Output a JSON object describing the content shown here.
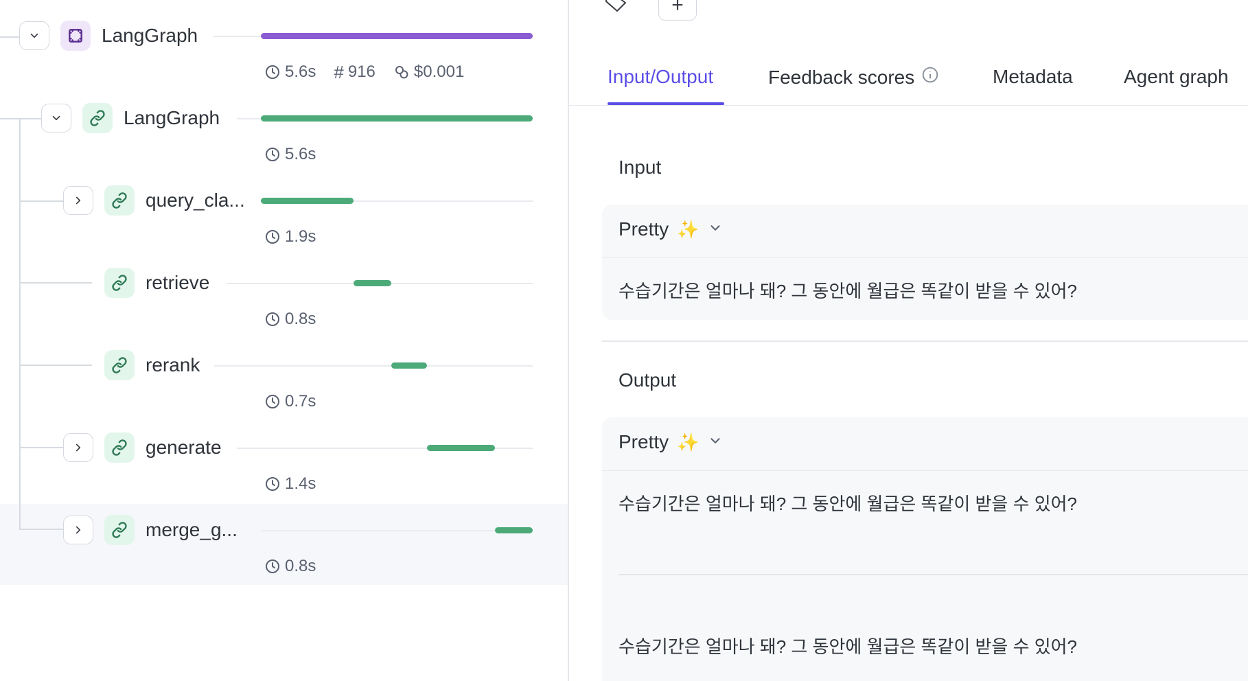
{
  "trace_tree": {
    "root": {
      "name": "LangGraph",
      "duration": "5.6s",
      "tokens": "916",
      "cost": "$0.001",
      "bar_start_fraction": 0.0,
      "bar_fraction": 1.0
    },
    "child": {
      "name": "LangGraph",
      "duration": "5.6s",
      "bar_start_fraction": 0.0,
      "bar_fraction": 1.0
    },
    "spans": [
      {
        "name": "query_cla...",
        "duration": "1.9s",
        "bar_start_fraction": 0.0,
        "bar_fraction": 0.34,
        "expandable": true
      },
      {
        "name": "retrieve",
        "duration": "0.8s",
        "bar_start_fraction": 0.34,
        "bar_fraction": 0.14,
        "expandable": false
      },
      {
        "name": "rerank",
        "duration": "0.7s",
        "bar_start_fraction": 0.48,
        "bar_fraction": 0.13,
        "expandable": false
      },
      {
        "name": "generate",
        "duration": "1.4s",
        "bar_start_fraction": 0.61,
        "bar_fraction": 0.25,
        "expandable": true
      },
      {
        "name": "merge_g...",
        "duration": "0.8s",
        "bar_start_fraction": 0.86,
        "bar_fraction": 0.14,
        "expandable": true,
        "selected": true
      }
    ]
  },
  "header": {
    "add_label": "+"
  },
  "tabs": [
    {
      "label": "Input/Output",
      "active": true
    },
    {
      "label": "Feedback scores",
      "active": false,
      "info": true
    },
    {
      "label": "Metadata",
      "active": false
    },
    {
      "label": "Agent graph",
      "active": false
    }
  ],
  "input": {
    "title": "Input",
    "format_label": "Pretty",
    "format_emoji": "✨",
    "text": "수습기간은 얼마나 돼? 그 동안에 월급은 똑같이 받을 수 있어?"
  },
  "output": {
    "title": "Output",
    "format_label": "Pretty",
    "format_emoji": "✨",
    "text_1": "수습기간은 얼마나 돼? 그 동안에 월급은 똑같이 받을 수 있어?",
    "text_2": "수습기간은 얼마나 돼? 그 동안에 월급은 똑같이 받을 수 있어?"
  },
  "colors": {
    "accent": "#5b4ee6",
    "root_bar": "#8a5cd1",
    "span_bar": "#4caa79"
  }
}
